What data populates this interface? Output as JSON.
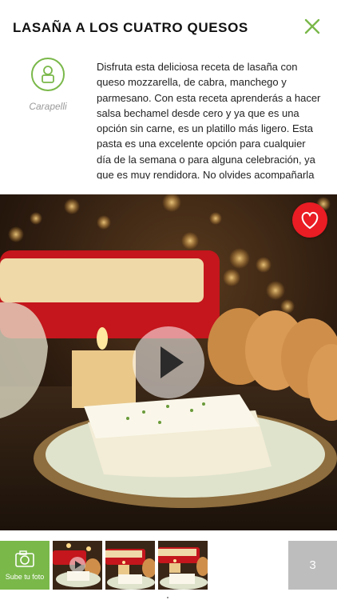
{
  "recipe": {
    "title": "LASAÑA A LOS CUATRO QUESOS",
    "author": "Carapelli",
    "description": "Disfruta esta deliciosa receta de lasaña con queso mozzarella, de cabra, manchego y parmesano. Con esta receta aprenderás a hacer salsa bechamel desde cero y ya que es una opción sin carne, es un platillo más ligero. Esta pasta es una excelente opción para cualquier día de la semana o para alguna celebración, ya que es muy rendidora. No olvides acompañarla con rebanadas de pan y de"
  },
  "icons": {
    "close": "close-icon",
    "avatar": "user-icon",
    "favorite": "heart-icon",
    "play": "play-icon",
    "camera": "camera-icon"
  },
  "gallery": {
    "upload_label": "Sube tu foto",
    "more_count": "3"
  },
  "colors": {
    "accent": "#7ab84a",
    "favorite": "#ea1c24",
    "count_bg": "#bdbdbd"
  }
}
